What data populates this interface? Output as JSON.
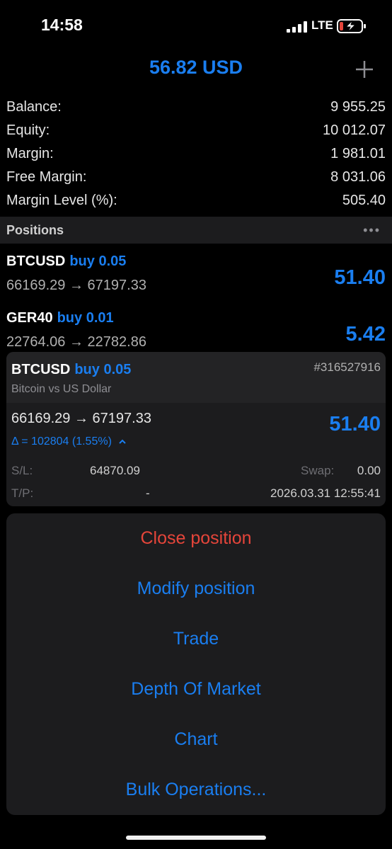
{
  "status_bar": {
    "time": "14:58",
    "network": "LTE"
  },
  "header": {
    "title": "56.82 USD",
    "add_icon": "plus-icon"
  },
  "account": [
    {
      "label": "Balance:",
      "value": "9 955.25"
    },
    {
      "label": "Equity:",
      "value": "10 012.07"
    },
    {
      "label": "Margin:",
      "value": "1 981.01"
    },
    {
      "label": "Free Margin:",
      "value": "8 031.06"
    },
    {
      "label": "Margin Level (%):",
      "value": "505.40"
    }
  ],
  "positions": {
    "title": "Positions",
    "more_icon": "more-icon",
    "items": [
      {
        "symbol": "BTCUSD",
        "side": "buy 0.05",
        "prices": "66169.29 → 67197.33",
        "profit": "51.40"
      },
      {
        "symbol": "GER40",
        "side": "buy 0.01",
        "prices": "22764.06 → 22782.86",
        "profit": "5.42"
      }
    ]
  },
  "detail": {
    "symbol": "BTCUSD",
    "side": "buy 0.05",
    "ticket": "#316527916",
    "description": "Bitcoin vs US Dollar",
    "prices": "66169.29 → 67197.33",
    "profit": "51.40",
    "delta": "Δ = 102804 (1.55%)",
    "sl_label": "S/L:",
    "sl_value": "64870.09",
    "swap_label": "Swap:",
    "swap_value": "0.00",
    "tp_label": "T/P:",
    "tp_value": "-",
    "time": "2026.03.31 12:55:41"
  },
  "actions": [
    {
      "label": "Close position",
      "style": "destructive"
    },
    {
      "label": "Modify position",
      "style": "default"
    },
    {
      "label": "Trade",
      "style": "default"
    },
    {
      "label": "Depth Of Market",
      "style": "default"
    },
    {
      "label": "Chart",
      "style": "default"
    },
    {
      "label": "Bulk Operations...",
      "style": "default"
    }
  ],
  "colors": {
    "accent": "#1a7ef0",
    "destructive": "#e5453a",
    "background": "#000000",
    "card": "#1c1c1e"
  }
}
